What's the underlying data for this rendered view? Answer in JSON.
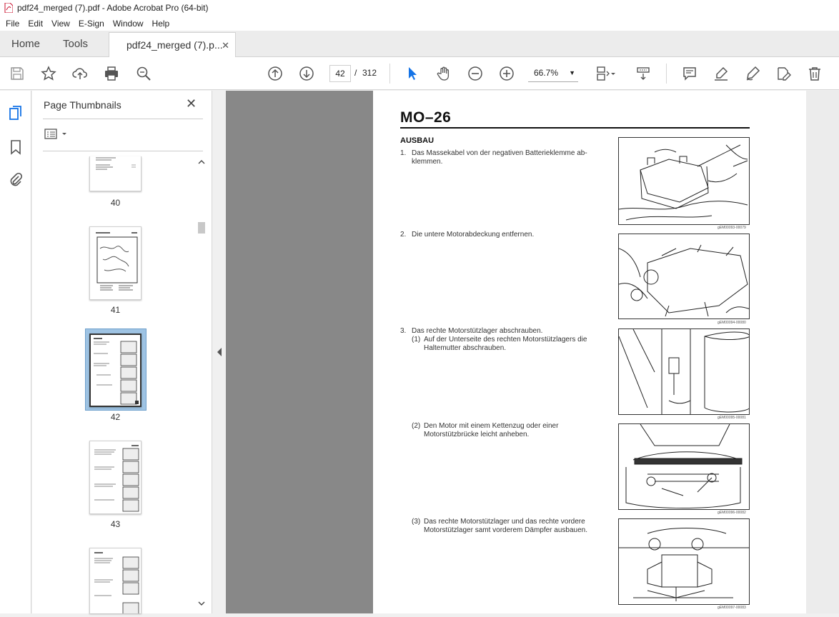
{
  "window": {
    "title": "pdf24_merged (7).pdf - Adobe Acrobat Pro (64-bit)"
  },
  "menu": [
    "File",
    "Edit",
    "View",
    "E-Sign",
    "Window",
    "Help"
  ],
  "tabs": {
    "home": "Home",
    "tools": "Tools",
    "document": "pdf24_merged (7).p...",
    "close": "✕"
  },
  "toolbar": {
    "current_page": "42",
    "page_separator": "/",
    "total_pages": "312",
    "zoom": "66.7%"
  },
  "thumbnails": {
    "title": "Page Thumbnails",
    "close": "✕",
    "pages": [
      "40",
      "41",
      "42",
      "43"
    ],
    "selected": "42"
  },
  "document": {
    "header": "MO–26",
    "section": "AUSBAU",
    "steps": [
      {
        "num": "1.",
        "line1": "Das Massekabel von der negativen Batterieklemme ab-",
        "line2": "klemmen."
      },
      {
        "num": "2.",
        "line1": "Die untere Motorabdeckung entfernen.",
        "line2": ""
      },
      {
        "num": "3.",
        "line1": "Das rechte Motorstützlager abschrauben.",
        "line2": ""
      }
    ],
    "substeps": [
      {
        "num": "(1)",
        "line1": "Auf der Unterseite des rechten Motorstützlagers die",
        "line2": "Haltemutter abschrauben."
      },
      {
        "num": "(2)",
        "line1": "Den Motor mit einem Kettenzug oder einer",
        "line2": "Motorstützbrücke leicht anheben."
      },
      {
        "num": "(3)",
        "line1": "Das rechte Motorstützlager und das rechte vordere",
        "line2": "Motorstützlager samt vorderem Dämpfer ausbauen."
      }
    ],
    "captions": [
      "gEM00093-00079",
      "gEM00094-00080",
      "gEM00095-00081",
      "gEM00096-00082",
      "gEM00097-00083"
    ]
  },
  "colors": {
    "accent": "#1473e6",
    "selection": "#9ec3e3",
    "doc_bg": "#888888"
  }
}
